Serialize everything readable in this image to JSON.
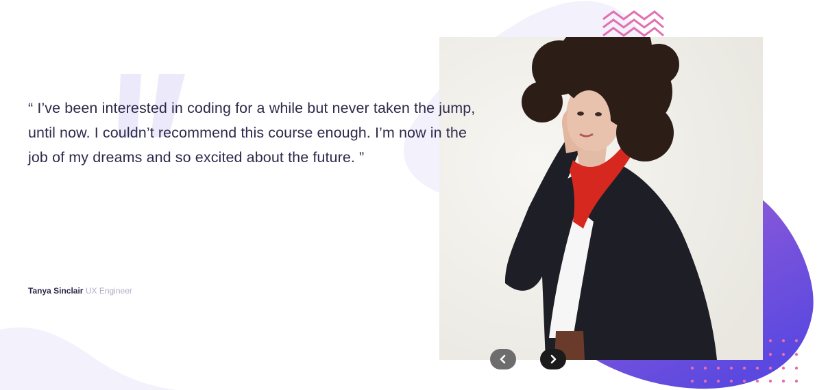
{
  "testimonial": {
    "quote": "“ I’ve been interested in coding for a while but never taken the jump, until now. I couldn’t recommend this course enough. I’m now in the job of my dreams and so excited about the future. ”",
    "author_name": "Tanya Sinclair",
    "author_role": "UX Engineer"
  },
  "icons": {
    "prev": "chevron-left-icon",
    "next": "chevron-right-icon",
    "quote": "quote-mark-icon",
    "zigzag": "zigzag-pattern-icon",
    "dots": "dot-grid-pattern"
  },
  "colors": {
    "text_dark": "#2d2a4a",
    "text_muted": "#b0acc8",
    "quote_mark": "#ebe9fa",
    "blob_light": "#f2f1fc",
    "purple_light": "#9c5fd6",
    "purple_dark": "#5a48e0",
    "zigzag": "#e26fb0",
    "nav_prev": "#6d6d6d",
    "nav_next": "#1b1b1b"
  }
}
